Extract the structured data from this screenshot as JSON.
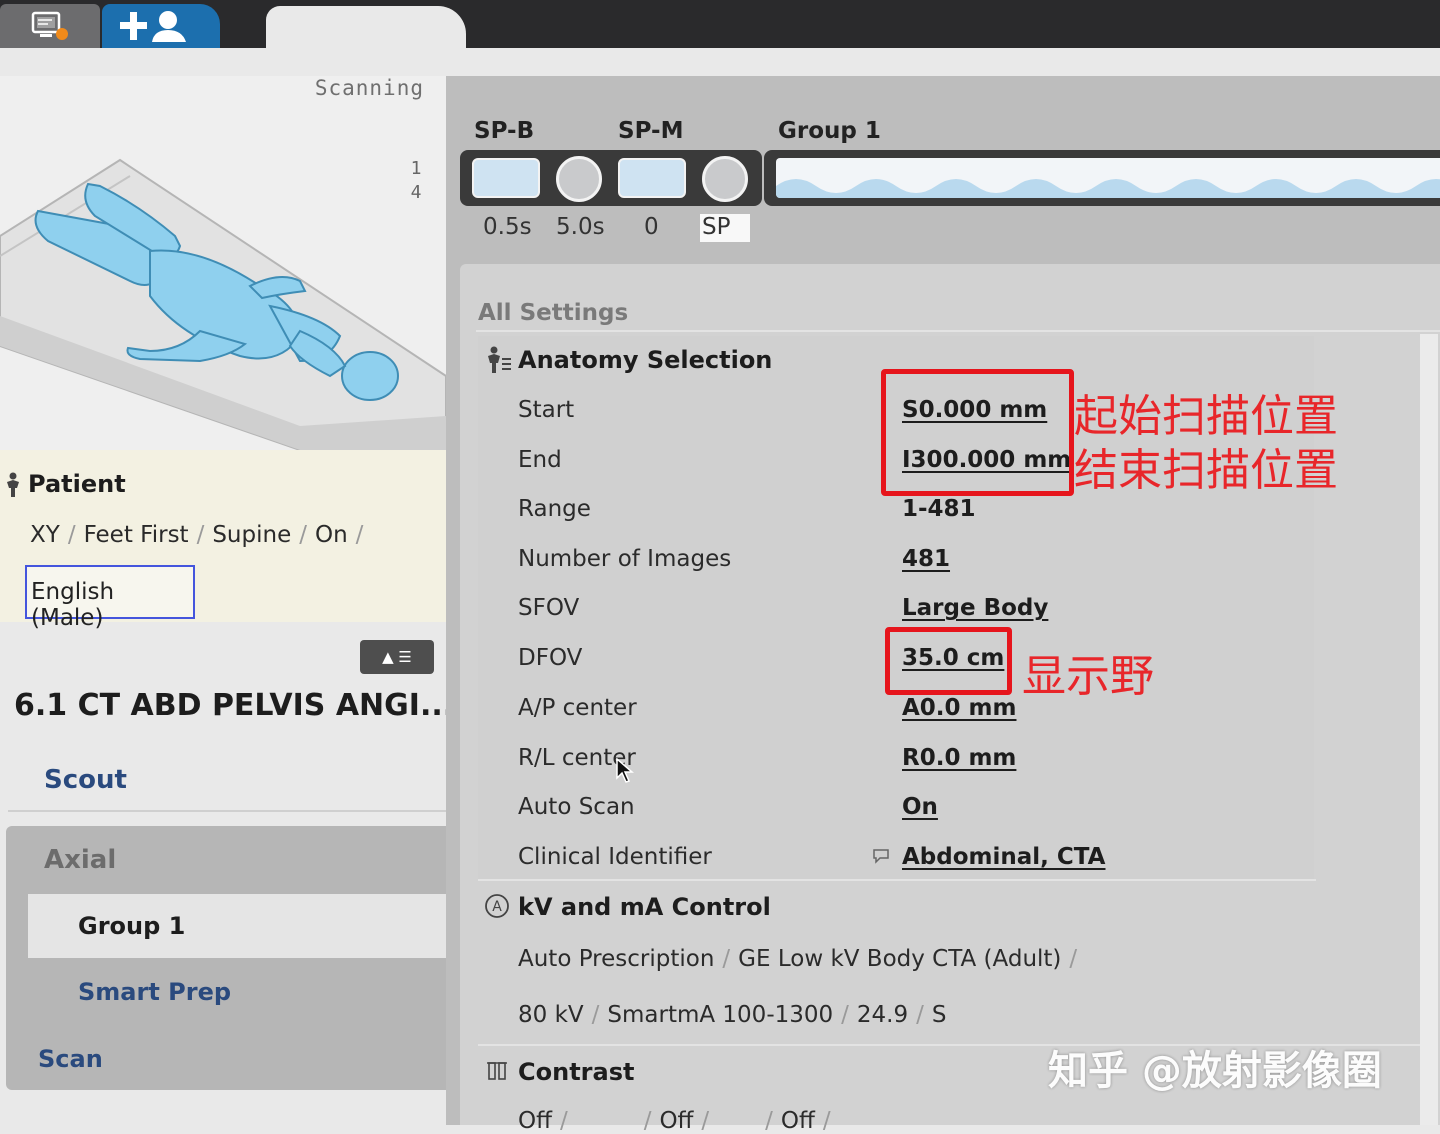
{
  "header": {
    "tabs": [
      {
        "name": "monitor",
        "icon": "monitor-alert-icon"
      },
      {
        "name": "add-patient",
        "icon": "add-patient-icon"
      },
      {
        "name": "active",
        "icon": ""
      }
    ]
  },
  "scanning": {
    "label": "Scanning",
    "digits": [
      "1",
      "4"
    ]
  },
  "patient": {
    "title": "Patient",
    "icon": "patient-icon",
    "position": [
      "XY",
      "Feet First",
      "Supine",
      "On"
    ],
    "language": "English (Male)"
  },
  "protocol": {
    "title": "6.1 CT ABD PELVIS ANGI...",
    "collapse_icon": "collapse-list-icon",
    "scout": "Scout",
    "series_type": "Axial",
    "group": "Group 1",
    "smart_prep": "Smart Prep",
    "scan": "Scan"
  },
  "timeline": {
    "labels": {
      "spb": "SP-B",
      "spm": "SP-M",
      "group": "Group 1"
    },
    "times": [
      "0.5s",
      "5.0s",
      "0",
      "SP"
    ]
  },
  "settings": {
    "title": "All Settings",
    "anatomy": {
      "title": "Anatomy Selection",
      "icon": "anatomy-icon",
      "rows": [
        {
          "label": "Start",
          "value": "S0.000 mm"
        },
        {
          "label": "End",
          "value": "I300.000 mm"
        },
        {
          "label": "Range",
          "value": "1-481"
        },
        {
          "label": "Number of Images",
          "value": "481"
        },
        {
          "label": "SFOV",
          "value": "Large Body"
        },
        {
          "label": "DFOV",
          "value": "35.0 cm"
        },
        {
          "label": "A/P center",
          "value": "A0.0 mm"
        },
        {
          "label": "R/L center",
          "value": "R0.0 mm"
        },
        {
          "label": "Auto Scan",
          "value": "On"
        },
        {
          "label": "Clinical Identifier",
          "value": "Abdominal, CTA"
        }
      ],
      "clinical_icon": "comment-icon"
    },
    "kv": {
      "title": "kV and mA Control",
      "icon": "auto-a-icon",
      "line1": [
        "Auto Prescription",
        "GE Low kV Body CTA (Adult)"
      ],
      "line2": [
        "80 kV",
        "SmartmA 100-1300",
        "24.9",
        "S"
      ]
    },
    "contrast": {
      "title": "Contrast",
      "icon": "contrast-syringe-icon",
      "values": [
        "Off",
        "Off",
        "Off"
      ]
    }
  },
  "annotations": {
    "start_note": "起始扫描位置",
    "end_note": "结束扫描位置",
    "dfov_note": "显示野",
    "annotation_color": "#e6151c"
  },
  "watermark": "知乎 @放射影像圈",
  "cursor_icon": "mouse-pointer-icon"
}
